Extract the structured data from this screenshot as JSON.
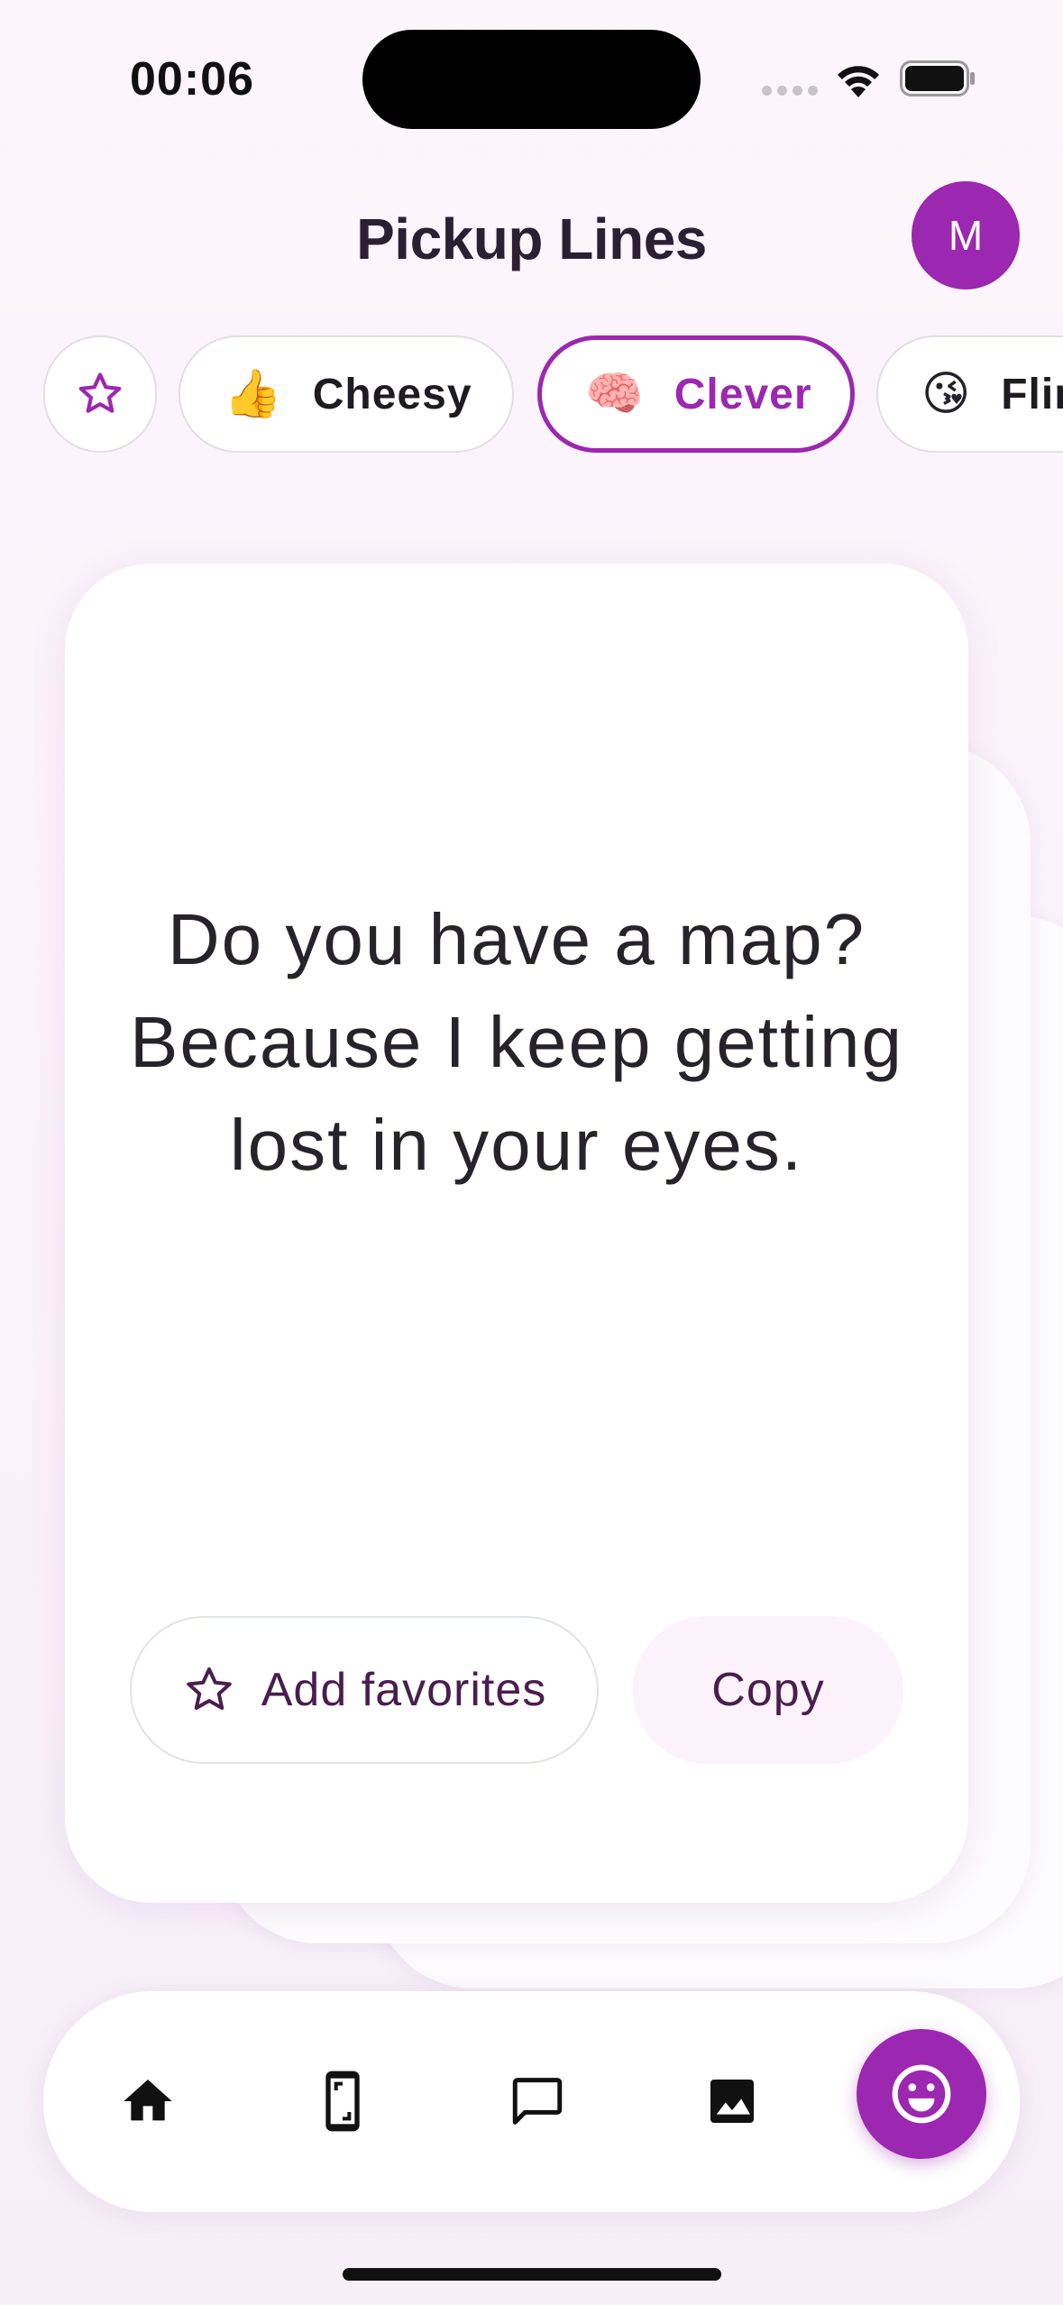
{
  "status_bar": {
    "time": "00:06"
  },
  "header": {
    "title": "Pickup Lines",
    "avatar_initial": "M"
  },
  "categories": [
    {
      "emoji": "👍",
      "label": "Cheesy",
      "selected": false
    },
    {
      "emoji": "🧠",
      "label": "Clever",
      "selected": true
    },
    {
      "emoji": "😘",
      "label": "Flirty",
      "selected": false
    }
  ],
  "card": {
    "text": "Do you have a map? Because I keep getting lost in your eyes.",
    "favorite_label": "Add favorites",
    "copy_label": "Copy"
  },
  "bottom_nav": {
    "items": [
      {
        "icon": "home-icon"
      },
      {
        "icon": "phone-frame-icon"
      },
      {
        "icon": "chat-icon"
      },
      {
        "icon": "image-icon"
      },
      {
        "icon": "smiley-icon",
        "active": true
      }
    ]
  },
  "colors": {
    "accent": "#9c27b0",
    "text_dark": "#24212b",
    "button_text": "#4a1d4f",
    "background": "#fcf5fc"
  }
}
